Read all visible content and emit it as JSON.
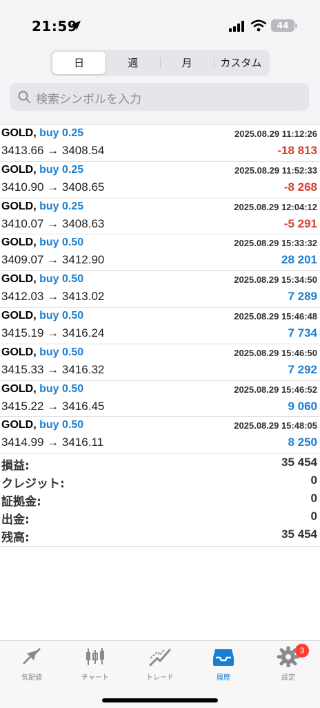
{
  "status_bar": {
    "time": "21:59",
    "battery": "44"
  },
  "segments": [
    {
      "label": "日",
      "active": true
    },
    {
      "label": "週",
      "active": false
    },
    {
      "label": "月",
      "active": false
    },
    {
      "label": "カスタム",
      "active": false
    }
  ],
  "search": {
    "placeholder": "検索シンボルを入力"
  },
  "deals": [
    {
      "symbol": "GOLD,",
      "direction": "buy 0.25",
      "time": "2025.08.29 11:12:26",
      "prices": "3413.66 → 3408.54",
      "profit": "-18 813"
    },
    {
      "symbol": "GOLD,",
      "direction": "buy 0.25",
      "time": "2025.08.29 11:52:33",
      "prices": "3410.90 → 3408.65",
      "profit": "-8 268"
    },
    {
      "symbol": "GOLD,",
      "direction": "buy 0.25",
      "time": "2025.08.29 12:04:12",
      "prices": "3410.07 → 3408.63",
      "profit": "-5 291"
    },
    {
      "symbol": "GOLD,",
      "direction": "buy 0.50",
      "time": "2025.08.29 15:33:32",
      "prices": "3409.07 → 3412.90",
      "profit": "28 201"
    },
    {
      "symbol": "GOLD,",
      "direction": "buy 0.50",
      "time": "2025.08.29 15:34:50",
      "prices": "3412.03 → 3413.02",
      "profit": "7 289"
    },
    {
      "symbol": "GOLD,",
      "direction": "buy 0.50",
      "time": "2025.08.29 15:46:48",
      "prices": "3415.19 → 3416.24",
      "profit": "7 734"
    },
    {
      "symbol": "GOLD,",
      "direction": "buy 0.50",
      "time": "2025.08.29 15:46:50",
      "prices": "3415.33 → 3416.32",
      "profit": "7 292"
    },
    {
      "symbol": "GOLD,",
      "direction": "buy 0.50",
      "time": "2025.08.29 15:46:52",
      "prices": "3415.22 → 3416.45",
      "profit": "9 060"
    },
    {
      "symbol": "GOLD,",
      "direction": "buy 0.50",
      "time": "2025.08.29 15:48:05",
      "prices": "3414.99 → 3416.11",
      "profit": "8 250"
    }
  ],
  "summary": [
    {
      "label": "損益:",
      "value": "35 454"
    },
    {
      "label": "クレジット:",
      "value": "0"
    },
    {
      "label": "証拠金:",
      "value": "0"
    },
    {
      "label": "出金:",
      "value": "0"
    },
    {
      "label": "残高:",
      "value": "35 454"
    }
  ],
  "tabbar": {
    "items": [
      {
        "label": "気配値",
        "icon": "quotes-icon",
        "active": false
      },
      {
        "label": "チャート",
        "icon": "chart-icon",
        "active": false
      },
      {
        "label": "トレード",
        "icon": "trade-icon",
        "active": false
      },
      {
        "label": "履歴",
        "icon": "history-icon",
        "active": true
      },
      {
        "label": "設定",
        "icon": "settings-icon",
        "active": false
      }
    ],
    "settings_badge": "3"
  },
  "colors": {
    "accent": "#1a7fd4",
    "loss": "#d6402f",
    "inactive": "#8a8a8e"
  }
}
